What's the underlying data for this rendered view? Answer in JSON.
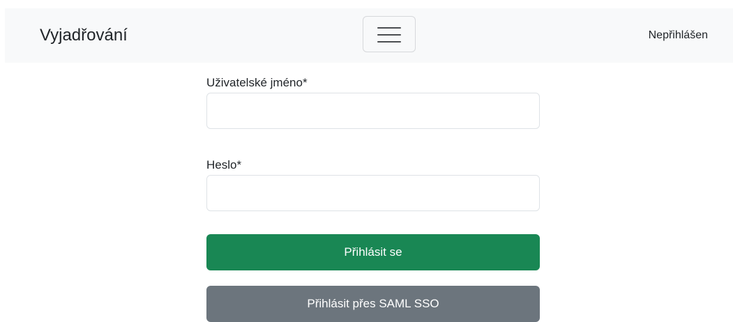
{
  "navbar": {
    "brand": "Vyjadřování",
    "status": "Nepřihlášen"
  },
  "form": {
    "username_label": "Uživatelské jméno*",
    "username_value": "",
    "password_label": "Heslo*",
    "password_value": "",
    "login_button": "Přihlásit se",
    "sso_button": "Přihlásit přes SAML SSO"
  },
  "colors": {
    "navbar_bg": "#f8f9fa",
    "primary": "#198754",
    "secondary": "#6c757d"
  },
  "icons": {
    "toggler": "hamburger-menu-icon"
  }
}
